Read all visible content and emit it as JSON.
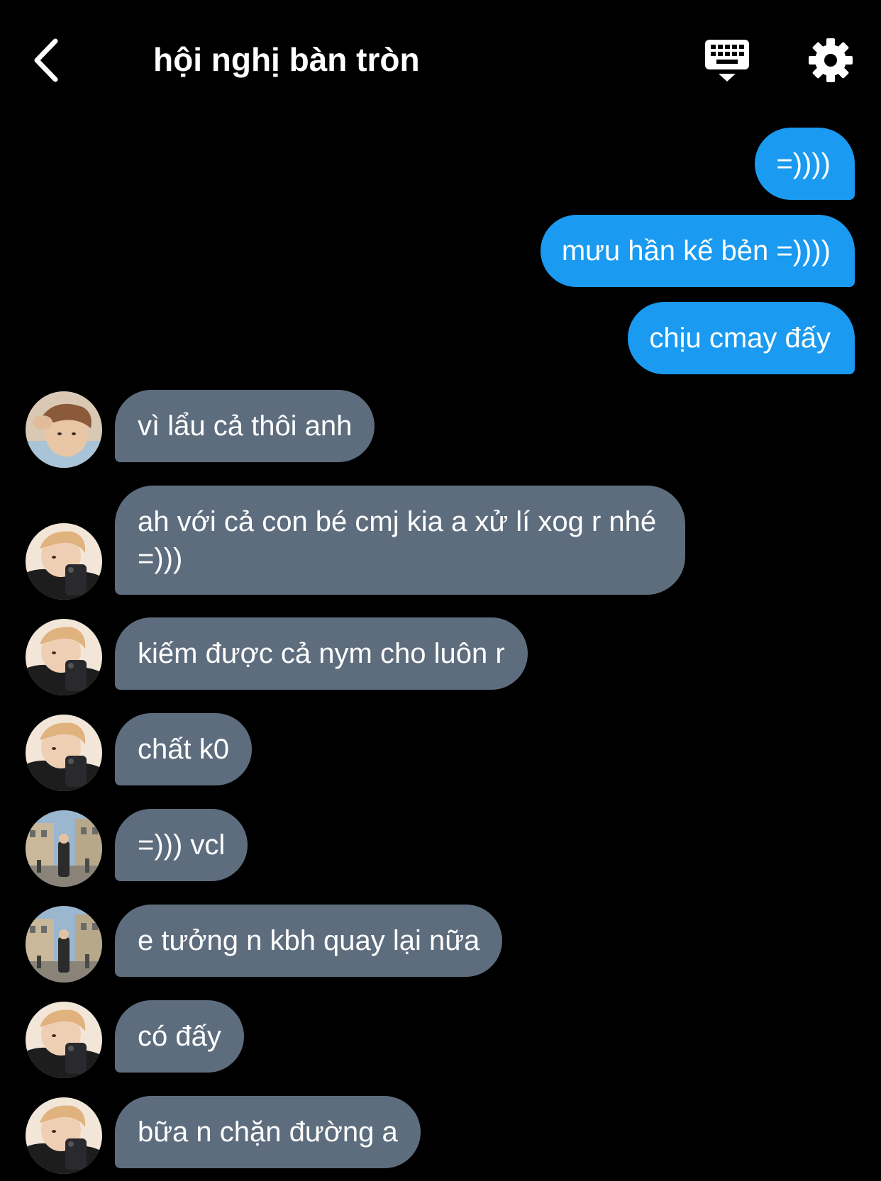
{
  "header": {
    "title": "hội nghị bàn tròn",
    "back_icon": "chevron-left-icon",
    "keyboard_icon": "keyboard-icon",
    "settings_icon": "gear-icon"
  },
  "colors": {
    "background": "#000000",
    "outgoing_bubble": "#1a9af0",
    "incoming_bubble": "#5e6d7e",
    "text": "#ffffff"
  },
  "messages": [
    {
      "direction": "outgoing",
      "text": "=))))"
    },
    {
      "direction": "outgoing",
      "text": "mưu hần kế bẻn =))))"
    },
    {
      "direction": "outgoing",
      "text": "chịu cmay đấy"
    },
    {
      "direction": "incoming",
      "avatar": "avatar-a",
      "text": "vì lẩu cả thôi anh"
    },
    {
      "direction": "incoming",
      "avatar": "avatar-b",
      "text": "ah với cả con bé cmj kia a xử lí xog r nhé =)))"
    },
    {
      "direction": "incoming",
      "avatar": "avatar-b",
      "text": "kiếm được cả nym cho luôn r"
    },
    {
      "direction": "incoming",
      "avatar": "avatar-b",
      "text": "chất k0"
    },
    {
      "direction": "incoming",
      "avatar": "avatar-c",
      "text": "=))) vcl"
    },
    {
      "direction": "incoming",
      "avatar": "avatar-c",
      "text": "e tưởng n kbh quay lại nữa"
    },
    {
      "direction": "incoming",
      "avatar": "avatar-b",
      "text": "có đấy"
    },
    {
      "direction": "incoming",
      "avatar": "avatar-b",
      "text": "bữa n chặn đường a"
    }
  ]
}
